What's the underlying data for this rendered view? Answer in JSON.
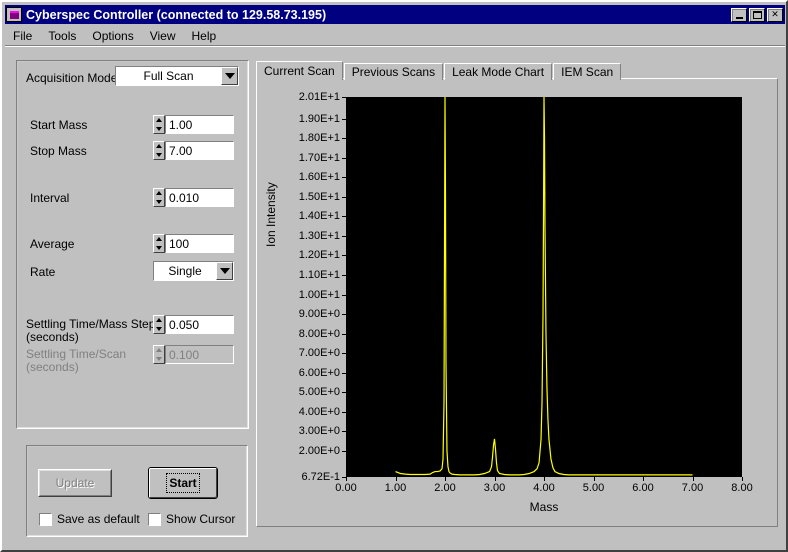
{
  "window": {
    "title": "Cyberspec Controller (connected to 129.58.73.195)",
    "icon": "app-icon",
    "buttons": {
      "minimize": "minimize-icon",
      "maximize": "maximize-icon",
      "close": "close-icon"
    }
  },
  "menu": {
    "items": [
      "File",
      "Tools",
      "Options",
      "View",
      "Help"
    ]
  },
  "acquisition": {
    "mode_label": "Acquisition Mode",
    "mode_value": "Full Scan",
    "fields": [
      {
        "label": "Start Mass",
        "value": "1.00",
        "disabled": false
      },
      {
        "label": "Stop Mass",
        "value": "7.00",
        "disabled": false
      },
      {
        "label": "Interval",
        "value": "0.010",
        "disabled": false
      },
      {
        "label": "Average",
        "value": "100",
        "disabled": false
      }
    ],
    "rate_label": "Rate",
    "rate_value": "Single",
    "settling_mass_label_line1": "Settling Time/Mass Step",
    "settling_mass_label_line2": "(seconds)",
    "settling_mass_value": "0.050",
    "settling_scan_label_line1": "Settling Time/Scan",
    "settling_scan_label_line2": "(seconds)",
    "settling_scan_value": "0.100"
  },
  "actions": {
    "update_label": "Update",
    "start_label": "Start",
    "save_default_label": "Save as default",
    "show_cursor_label": "Show Cursor"
  },
  "tabs": [
    {
      "label": "Current Scan",
      "active": true
    },
    {
      "label": "Previous Scans",
      "active": false
    },
    {
      "label": "Leak Mode Chart",
      "active": false
    },
    {
      "label": "IEM Scan",
      "active": false
    }
  ],
  "colors": {
    "titlebar": "#000080",
    "face": "#c0c0c0",
    "plot_background": "#000000",
    "trace": "#ffff00"
  },
  "chart_data": {
    "type": "line",
    "title": "",
    "xlabel": "Mass",
    "ylabel": "Ion Intensity",
    "xlim": [
      0.0,
      8.0
    ],
    "ylim": [
      0.672,
      20.1
    ],
    "grid": false,
    "legend": null,
    "xticks": [
      "0.00",
      "1.00",
      "2.00",
      "3.00",
      "4.00",
      "5.00",
      "6.00",
      "7.00",
      "8.00"
    ],
    "xtick_values": [
      0,
      1,
      2,
      3,
      4,
      5,
      6,
      7,
      8
    ],
    "yticks": [
      "2.01E+1",
      "1.90E+1",
      "1.80E+1",
      "1.70E+1",
      "1.60E+1",
      "1.50E+1",
      "1.40E+1",
      "1.30E+1",
      "1.20E+1",
      "1.10E+1",
      "1.00E+1",
      "9.00E+0",
      "8.00E+0",
      "7.00E+0",
      "6.00E+0",
      "5.00E+0",
      "4.00E+0",
      "3.00E+0",
      "2.00E+0",
      "6.72E-1"
    ],
    "ytick_values": [
      20.1,
      19.0,
      18.0,
      17.0,
      16.0,
      15.0,
      14.0,
      13.0,
      12.0,
      11.0,
      10.0,
      9.0,
      8.0,
      7.0,
      6.0,
      5.0,
      4.0,
      3.0,
      2.0,
      0.672
    ],
    "series": [
      {
        "name": "Ion Intensity",
        "color": "#ffff00",
        "x": [
          1.0,
          1.05,
          1.1,
          1.2,
          1.3,
          1.4,
          1.5,
          1.6,
          1.7,
          1.75,
          1.8,
          1.85,
          1.9,
          1.94,
          1.96,
          1.98,
          1.99,
          2.0,
          2.01,
          2.02,
          2.04,
          2.06,
          2.08,
          2.1,
          2.14,
          2.2,
          2.3,
          2.4,
          2.5,
          2.6,
          2.7,
          2.8,
          2.9,
          2.94,
          2.96,
          2.98,
          3.0,
          3.02,
          3.04,
          3.06,
          3.1,
          3.2,
          3.3,
          3.4,
          3.5,
          3.6,
          3.7,
          3.8,
          3.86,
          3.9,
          3.94,
          3.96,
          3.98,
          3.99,
          4.0,
          4.01,
          4.02,
          4.04,
          4.06,
          4.08,
          4.1,
          4.14,
          4.18,
          4.22,
          4.3,
          4.4,
          4.5,
          4.6,
          4.8,
          5.0,
          5.5,
          6.0,
          6.5,
          7.0
        ],
        "y": [
          0.95,
          0.9,
          0.85,
          0.82,
          0.8,
          0.8,
          0.8,
          0.8,
          0.82,
          0.9,
          0.95,
          0.95,
          0.98,
          1.1,
          1.6,
          4.5,
          12.0,
          20.1,
          15.0,
          6.5,
          2.0,
          1.2,
          0.95,
          0.88,
          0.82,
          0.8,
          0.78,
          0.78,
          0.78,
          0.78,
          0.8,
          0.85,
          0.95,
          1.2,
          1.7,
          2.3,
          2.62,
          2.1,
          1.4,
          1.0,
          0.85,
          0.8,
          0.78,
          0.78,
          0.78,
          0.8,
          0.85,
          0.95,
          1.1,
          1.4,
          2.6,
          4.5,
          9.0,
          14.0,
          20.1,
          18.0,
          13.5,
          8.0,
          5.2,
          3.6,
          2.6,
          1.6,
          1.15,
          0.95,
          0.85,
          0.8,
          0.78,
          0.78,
          0.78,
          0.78,
          0.78,
          0.78,
          0.78,
          0.78
        ]
      }
    ]
  }
}
